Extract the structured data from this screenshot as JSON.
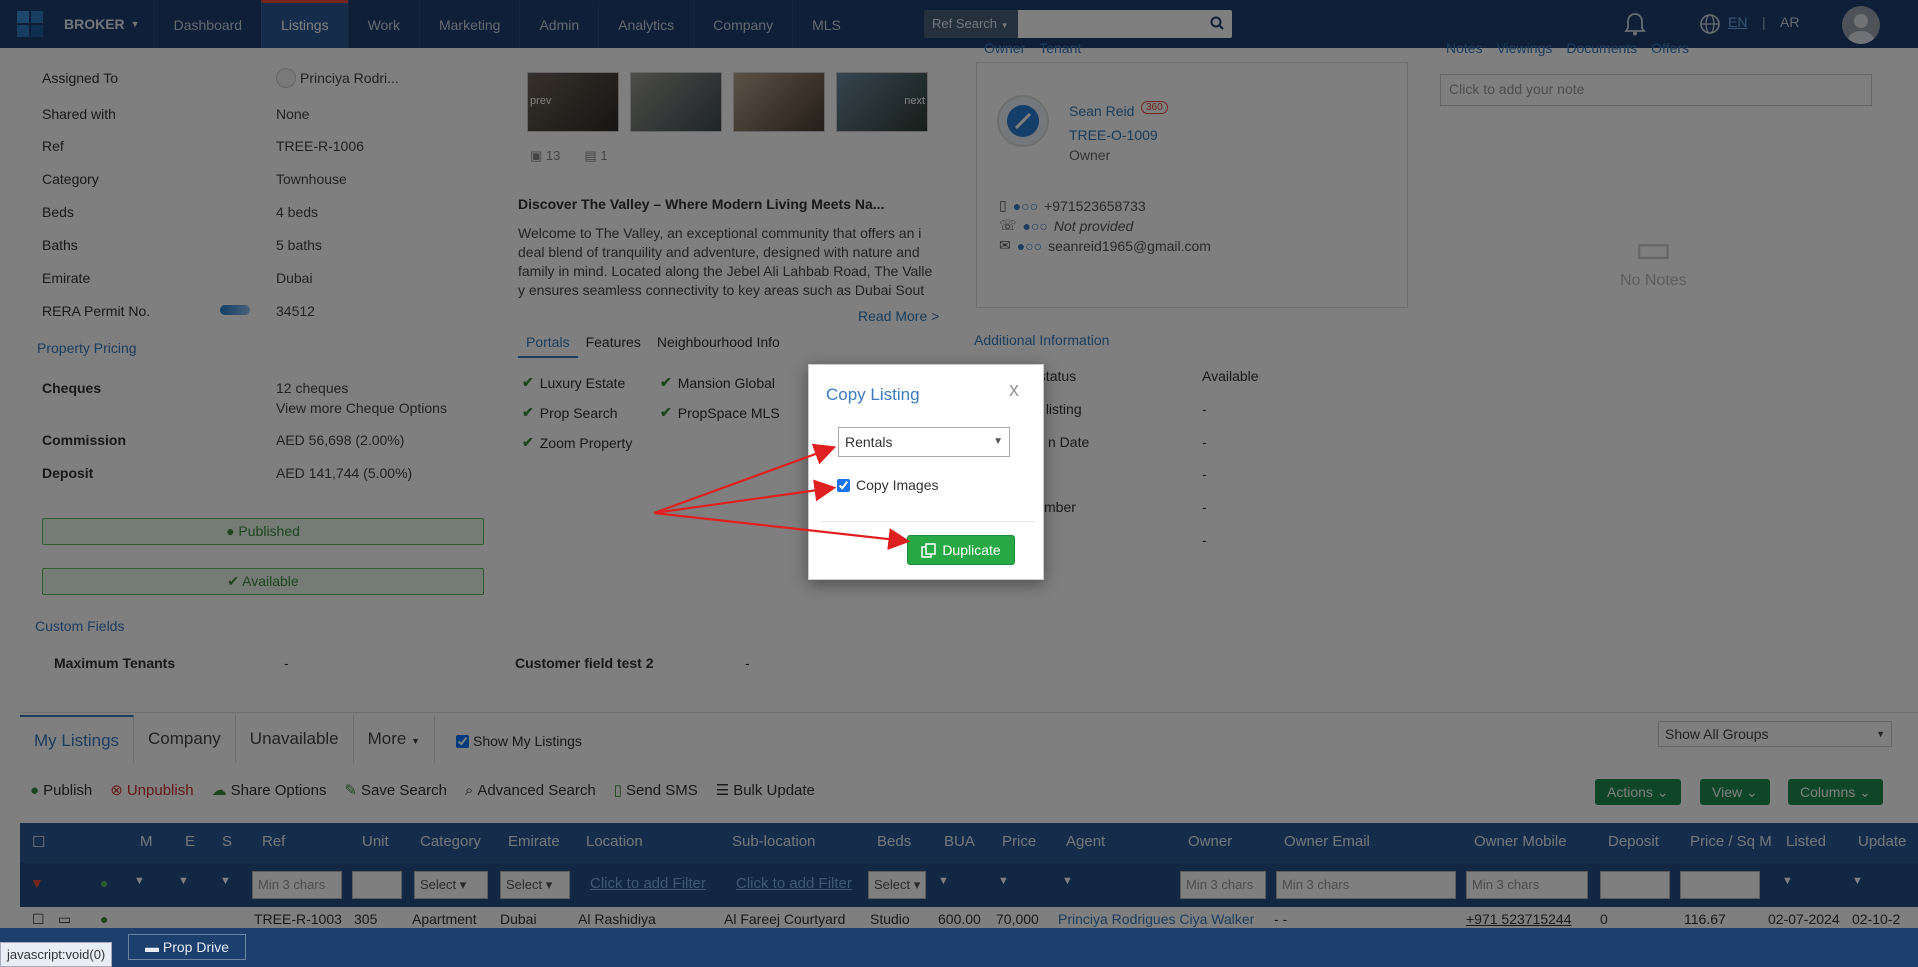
{
  "nav": {
    "brand": "BROKER",
    "items": [
      "Dashboard",
      "Listings",
      "Work",
      "Marketing",
      "Admin",
      "Analytics",
      "Company",
      "MLS"
    ],
    "search_select": "Ref Search",
    "lang_en": "EN",
    "lang_sep": "|",
    "lang_ar": "AR"
  },
  "details": {
    "assigned_to_label": "Assigned To",
    "assigned_to_value": "Princiya Rodri...",
    "shared_label": "Shared with",
    "shared_value": "None",
    "ref_label": "Ref",
    "ref_value": "TREE-R-1006",
    "category_label": "Category",
    "category_value": "Townhouse",
    "beds_label": "Beds",
    "beds_value": "4 beds",
    "baths_label": "Baths",
    "baths_value": "5 baths",
    "emirate_label": "Emirate",
    "emirate_value": "Dubai",
    "rera_label": "RERA Permit No.",
    "rera_value": "34512"
  },
  "pricing": {
    "title": "Property Pricing",
    "cheques_label": "Cheques",
    "cheques_value": "12 cheques",
    "cheques_link": "View more Cheque Options",
    "commission_label": "Commission",
    "commission_value": "AED 56,698 (2.00%)",
    "deposit_label": "Deposit",
    "deposit_value": "AED 141,744 (5.00%)"
  },
  "status": {
    "published": "Published",
    "available": "Available"
  },
  "media": {
    "prev": "prev",
    "next": "next",
    "images_count": "13",
    "videos_count": "1"
  },
  "description": {
    "title": "Discover The Valley – Where Modern Living Meets Na...",
    "text": "Welcome to The Valley, an exceptional community that offers an i deal blend of tranquility and adventure, designed with nature and family in mind. Located along the Jebel Ali Lahbab Road, The Valle y ensures seamless connectivity to key areas such as Dubai Sout",
    "read_more": "Read More >"
  },
  "mid_tabs": [
    "Portals",
    "Features",
    "Neighbourhood Info"
  ],
  "portals": [
    "Luxury Estate",
    "Mansion Global",
    "Prop Search",
    "PropSpace MLS",
    "Zoom Property"
  ],
  "owner": {
    "tabs": [
      "Owner",
      "Tenant"
    ],
    "name": "Sean Reid",
    "badge": "360",
    "ref": "TREE-O-1009",
    "role": "Owner",
    "mobile": "+971523658733",
    "phone": "Not provided",
    "email": "seanreid1965@gmail.com"
  },
  "additional": {
    "title": "Additional Information",
    "rows": [
      {
        "label": "Property status",
        "value": "Available"
      },
      {
        "label": "Source of listing",
        "value": "-"
      },
      {
        "label": "n Date",
        "value": "-"
      },
      {
        "label": "",
        "value": "-"
      },
      {
        "label": "mber",
        "value": "-"
      },
      {
        "label": "",
        "value": "-"
      }
    ]
  },
  "notes": {
    "tabs": [
      "Notes",
      "Viewings",
      "Documents",
      "Offers"
    ],
    "placeholder": "Click to add your note",
    "empty": "No Notes"
  },
  "custom": {
    "title": "Custom Fields",
    "field1_label": "Maximum Tenants",
    "field1_value": "-",
    "field2_label": "Customer field test 2",
    "field2_value": "-"
  },
  "list": {
    "tabs": [
      "My Listings",
      "Company",
      "Unavailable",
      "More"
    ],
    "show_mine": "Show My Listings",
    "group_select": "Show All Groups",
    "toolbar": [
      "Publish",
      "Unpublish",
      "Share Options",
      "Save Search",
      "Advanced Search",
      "Send SMS",
      "Bulk Update"
    ],
    "actions": "Actions",
    "view": "View",
    "columns": "Columns",
    "headers": [
      "M",
      "E",
      "S",
      "Ref",
      "Unit",
      "Category",
      "Emirate",
      "Location",
      "Sub-location",
      "Beds",
      "BUA",
      "Price",
      "Agent",
      "Owner",
      "Owner Email",
      "Owner Mobile",
      "Deposit",
      "Price / Sq M",
      "Listed",
      "Update"
    ],
    "filter_min": "Min 3 chars",
    "filter_select": "Select",
    "filter_link": "Click to add Filter",
    "row": [
      "TREE-R-1003",
      "305",
      "Apartment",
      "Dubai",
      "Al Rashidiya",
      "Al Fareej Courtyard",
      "Studio",
      "600.00",
      "70,000",
      "Princiya Rodrigues Ciya Walker",
      "- -",
      "+971 523715244",
      "0",
      "116.67",
      "02-07-2024",
      "02-10-2"
    ]
  },
  "statusbar": {
    "js": "javascript:void(0)",
    "prop_drive": "Prop Drive"
  },
  "modal": {
    "title": "Copy Listing",
    "close": "x",
    "select_value": "Rentals",
    "copy_images": "Copy Images",
    "duplicate": "Duplicate"
  }
}
